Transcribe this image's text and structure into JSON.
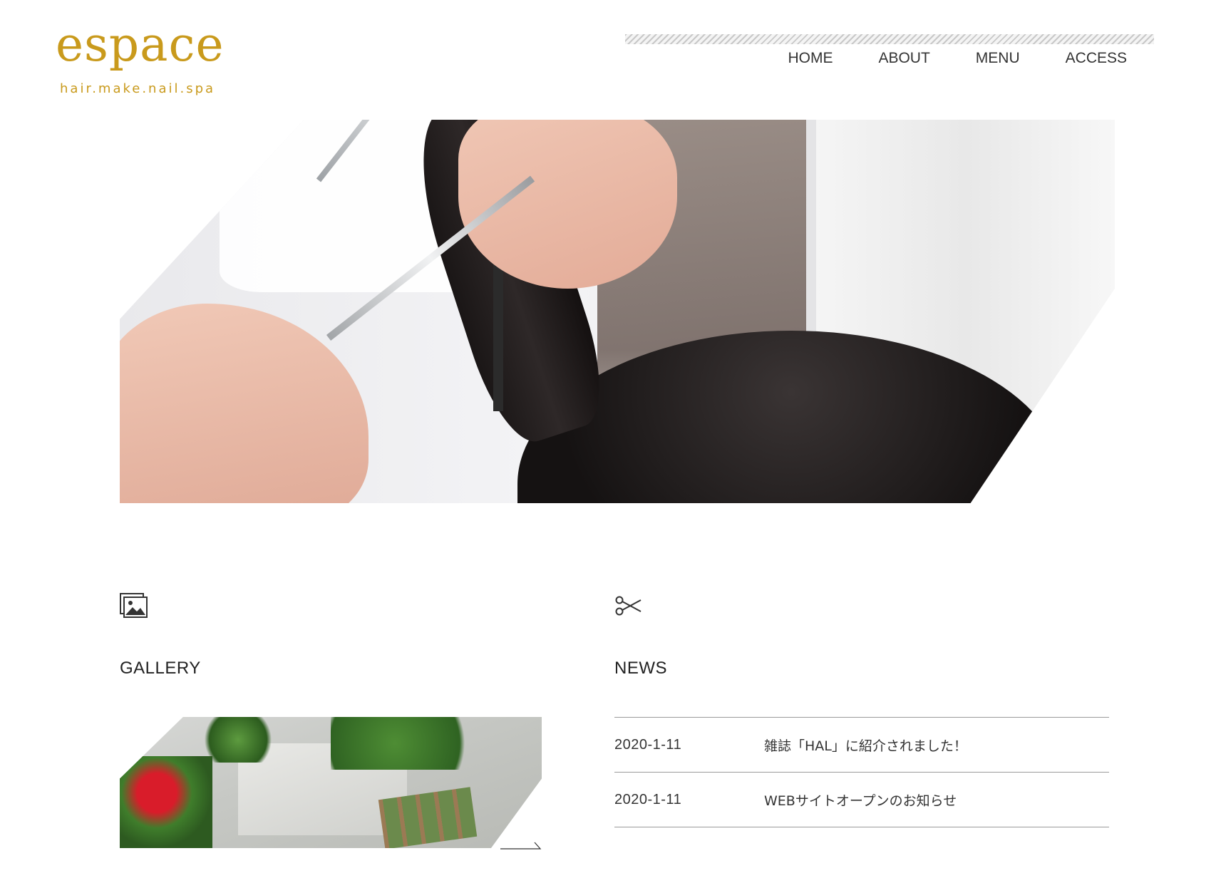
{
  "logo": {
    "main": "espace",
    "sub": "hair.make.nail.spa"
  },
  "nav": {
    "items": [
      "HOME",
      "ABOUT",
      "MENU",
      "ACCESS"
    ]
  },
  "gallery": {
    "title": "GALLERY",
    "icon": "image-icon"
  },
  "news": {
    "title": "NEWS",
    "icon": "scissors-icon",
    "items": [
      {
        "date": "2020-1-11",
        "text": "雑誌「HAL」に紹介されました！"
      },
      {
        "date": "2020-1-11",
        "text": "WEBサイトオープンのお知らせ"
      }
    ]
  },
  "colors": {
    "brand": "#c99a1c",
    "text": "#222222",
    "divider": "#9a9a9a"
  }
}
